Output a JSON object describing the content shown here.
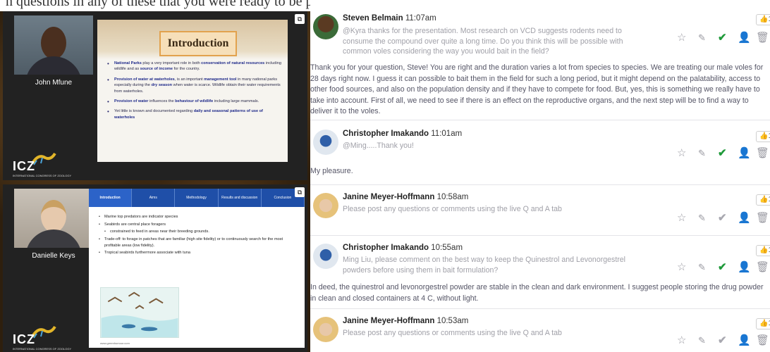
{
  "top_caption": "n questions in any of these that you were ready to be posted.",
  "sessions": [
    {
      "presenter": "John Mfune",
      "slide": {
        "title": "Introduction",
        "bullets": [
          {
            "pre": "",
            "b1": "National Parks",
            "mid": " play a very important role in both ",
            "b2": "conservation of natural resources",
            "post": " including wildlife and as ",
            "b3": "source of income",
            "end": " for the country."
          },
          {
            "pre": "",
            "b1": "Provision of water at waterholes",
            "mid": ", is an important ",
            "b2": "management tool",
            "post": " in many national parks especially during the ",
            "b3": "dry season",
            "end": " when water is scarce. Wildlife obtain their water requirements from waterholes."
          },
          {
            "pre": "",
            "b1": "Provision of water",
            "mid": " influences the ",
            "b2": "behaviour of wildlife",
            "post": " including large mammals.",
            "b3": "",
            "end": ""
          },
          {
            "pre": "Yet little is known and documented regarding ",
            "b1": "daily and seasonal patterns of use of waterholes",
            "mid": "",
            "b2": "",
            "post": "",
            "b3": "",
            "end": ""
          }
        ]
      },
      "logo": "ICZ",
      "logo_sub": "INTERNATIONAL CONGRESS OF ZOOLOGY"
    },
    {
      "presenter": "Danielle Keys",
      "slide": {
        "tabs": [
          "Introduction",
          "Aims",
          "Methodology",
          "Results and discussion",
          "Conclusion"
        ],
        "bullets": [
          {
            "text": "Marine top predators are indicator species",
            "sub": false
          },
          {
            "text": "Seabirds are central place foragers",
            "sub": false
          },
          {
            "text": "constrained to feed in areas near their breeding grounds.",
            "sub": true
          },
          {
            "text": "Trade-off: to forage in patches that are familiar (high site fidelity) or to continuously search for the most profitable areas (low fidelity).",
            "sub": false
          },
          {
            "text": "Tropical seabirds furthermore associate with tuna",
            "sub": false
          }
        ],
        "footer": "www.greenhumour.com"
      },
      "logo": "ICZ",
      "logo_sub": "INTERNATIONAL CONGRESS OF ZOOLOGY"
    }
  ],
  "messages": [
    {
      "author": "Steven Belmain",
      "time": "11:07am",
      "quote": "@Kyra thanks for the presentation. Most research on VCD suggests rodents need to consume the compound over quite a long time. Do you think this will be possible with common voles considering the way you would bait in the field?",
      "reply": "Thank you for your question, Steve! You are right and the duration varies a lot from species to species. We are treating our male voles for 28 days right now. I guess it can possible to bait them in the field for such a long period, but it might depend on the palatability, access to other food sources, and also on the population density and if they have to compete for food. But, yes, this is something we really have to take into account. First of all, we need to see if there is an effect on the reproductive organs, and the next step will be to find a way to deliver it to the voles.",
      "likes": "1",
      "answered": true
    },
    {
      "author": "Christopher Imakando",
      "time": "11:01am",
      "quote": "@Ming.....Thank you!",
      "reply": "My pleasure.",
      "likes": "1",
      "answered": true
    },
    {
      "author": "Janine Meyer-Hoffmann",
      "time": "10:58am",
      "quote": "Please post any questions or comments using the live Q and A tab",
      "reply": "",
      "likes": "1",
      "answered": false
    },
    {
      "author": "Christopher Imakando",
      "time": "10:55am",
      "quote": "Ming Liu, please comment on the best way to keep the Quinestrol and Levonorgestrel powders before using them in bait formulation?",
      "reply": "In deed, the quinestrol and levonorgestrel powder are stable in the clean and dark environment. I suggest people storing the drug powder in clean and closed containers at 4 C, without light.",
      "likes": "1",
      "answered": true
    },
    {
      "author": "Janine Meyer-Hoffmann",
      "time": "10:53am",
      "quote": "Please post any questions or comments using the live Q and A tab",
      "reply": "",
      "likes": "1",
      "answered": false
    }
  ],
  "icons": {
    "star": "☆",
    "pen": "✎",
    "check": "✔",
    "user": "👤",
    "trash": "🗑",
    "like": "👍",
    "popout": "⧉"
  },
  "colors": {
    "answered_check": "#1f9a3a",
    "pending_check": "#a8a8b0",
    "quote_text": "#a0a0a8"
  }
}
